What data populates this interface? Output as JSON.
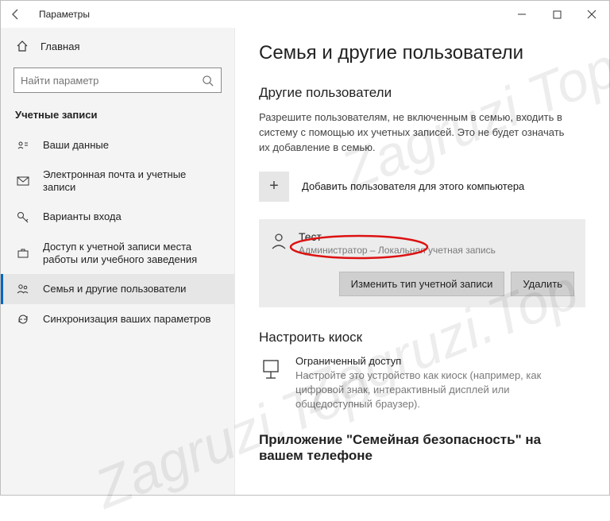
{
  "titlebar": {
    "title": "Параметры"
  },
  "sidebar": {
    "home": "Главная",
    "search_placeholder": "Найти параметр",
    "section": "Учетные записи",
    "items": [
      {
        "label": "Ваши данные"
      },
      {
        "label": "Электронная почта и учетные записи"
      },
      {
        "label": "Варианты входа"
      },
      {
        "label": "Доступ к учетной записи места работы или учебного заведения"
      },
      {
        "label": "Семья и другие пользователи"
      },
      {
        "label": "Синхронизация ваших параметров"
      }
    ]
  },
  "main": {
    "title": "Семья и другие пользователи",
    "other_users_heading": "Другие пользователи",
    "other_users_desc": "Разрешите пользователям, не включенным в семью, входить в систему с помощью их учетных записей. Это не будет означать их добавление в семью.",
    "add_user_label": "Добавить пользователя для этого компьютера",
    "user": {
      "name": "Тест",
      "role": "Администратор – Локальная учетная запись",
      "change_type_btn": "Изменить тип учетной записи",
      "delete_btn": "Удалить"
    },
    "kiosk_heading": "Настроить киоск",
    "kiosk": {
      "title": "Ограниченный доступ",
      "desc": "Настройте это устройство как киоск (например, как цифровой знак, интерактивный дисплей или общедоступный браузер)."
    },
    "app_heading": "Приложение \"Семейная безопасность\" на вашем телефоне"
  },
  "watermark": "Zagruzi.Top"
}
